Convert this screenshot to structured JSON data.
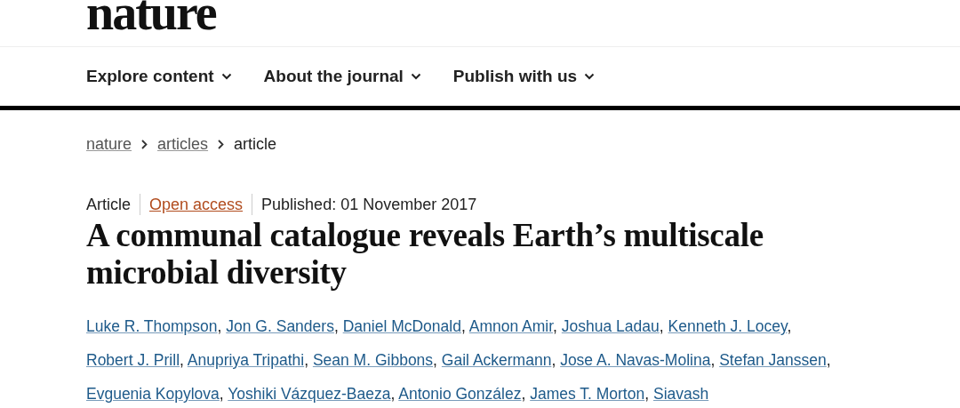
{
  "logo": "nature",
  "nav": [
    {
      "label": "Explore content"
    },
    {
      "label": "About the journal"
    },
    {
      "label": "Publish with us"
    }
  ],
  "breadcrumb": [
    {
      "label": "nature",
      "kind": "link"
    },
    {
      "label": "articles",
      "kind": "link"
    },
    {
      "label": "article",
      "kind": "current"
    }
  ],
  "meta": {
    "type": "Article",
    "access": "Open access",
    "published": "Published: 01 November 2017"
  },
  "title": "A communal catalogue reveals Earth’s multiscale microbial diversity",
  "authors": [
    {
      "name": "Luke R. Thompson",
      "separator": ","
    },
    {
      "name": "Jon G. Sanders",
      "separator": ","
    },
    {
      "name": "Daniel McDonald",
      "separator": ","
    },
    {
      "name": "Amnon Amir",
      "separator": ","
    },
    {
      "name": "Joshua Ladau",
      "separator": ","
    },
    {
      "name": "Kenneth J. Locey",
      "separator": ","
    },
    {
      "name": "Robert J. Prill",
      "separator": ","
    },
    {
      "name": "Anupriya Tripathi",
      "separator": ","
    },
    {
      "name": "Sean M. Gibbons",
      "separator": ","
    },
    {
      "name": "Gail Ackermann",
      "separator": ","
    },
    {
      "name": "Jose A. Navas-Molina",
      "separator": ","
    },
    {
      "name": "Stefan Janssen",
      "separator": ","
    },
    {
      "name": "Evguenia Kopylova",
      "separator": ","
    },
    {
      "name": "Yoshiki Vázquez-Baeza",
      "separator": ","
    },
    {
      "name": "Antonio González",
      "separator": ","
    },
    {
      "name": "James T. Morton",
      "separator": ","
    },
    {
      "name": "Siavash"
    }
  ]
}
